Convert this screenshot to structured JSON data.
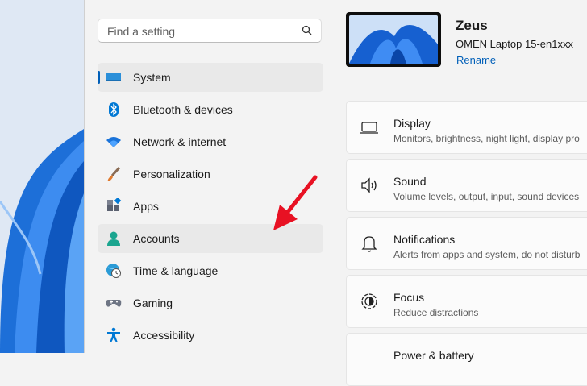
{
  "search": {
    "placeholder": "Find a setting"
  },
  "nav": [
    {
      "label": "System",
      "icon": "system-icon",
      "selected": true
    },
    {
      "label": "Bluetooth & devices",
      "icon": "bluetooth-icon"
    },
    {
      "label": "Network & internet",
      "icon": "wifi-icon"
    },
    {
      "label": "Personalization",
      "icon": "brush-icon"
    },
    {
      "label": "Apps",
      "icon": "apps-icon"
    },
    {
      "label": "Accounts",
      "icon": "person-icon",
      "hover": true
    },
    {
      "label": "Time & language",
      "icon": "globe-clock-icon"
    },
    {
      "label": "Gaming",
      "icon": "gamepad-icon"
    },
    {
      "label": "Accessibility",
      "icon": "accessibility-icon"
    }
  ],
  "device": {
    "name": "Zeus",
    "model": "OMEN Laptop 15-en1xxx",
    "rename_label": "Rename"
  },
  "cards": [
    {
      "title": "Display",
      "desc": "Monitors, brightness, night light, display pro",
      "icon": "monitor-icon"
    },
    {
      "title": "Sound",
      "desc": "Volume levels, output, input, sound devices",
      "icon": "speaker-icon"
    },
    {
      "title": "Notifications",
      "desc": "Alerts from apps and system, do not disturb",
      "icon": "bell-icon"
    },
    {
      "title": "Focus",
      "desc": "Reduce distractions",
      "icon": "focus-icon"
    },
    {
      "title": "Power & battery",
      "desc": "",
      "icon": "power-icon"
    }
  ],
  "colors": {
    "accent": "#005fb8",
    "arrow": "#e81123",
    "background": "#f3f3f3"
  }
}
